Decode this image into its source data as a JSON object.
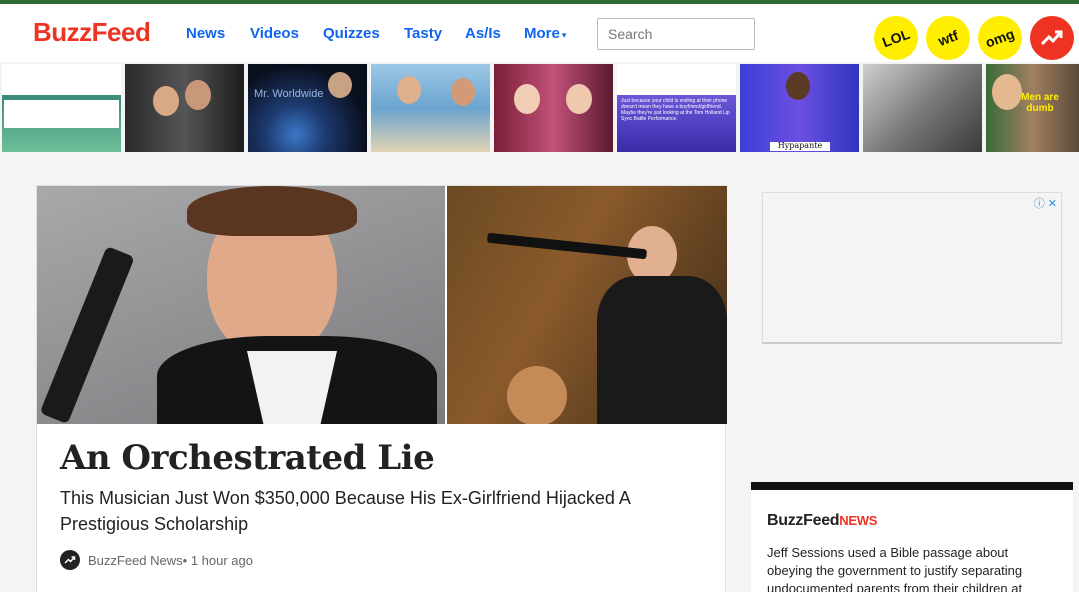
{
  "header": {
    "logo": "BuzzFeed",
    "nav": [
      {
        "label": "News"
      },
      {
        "label": "Videos"
      },
      {
        "label": "Quizzes"
      },
      {
        "label": "Tasty"
      },
      {
        "label": "As/Is"
      },
      {
        "label": "More"
      }
    ],
    "search_placeholder": "Search",
    "badges": [
      "LOL",
      "wtf",
      "omg",
      "trending"
    ]
  },
  "strip": {
    "captions": {
      "t6": "Just because your child is smiling at their phone doesn't mean they have a boyfriend/girlfriend. Maybe they're just looking at the Tom Holland Lip Sync Battle Performance.",
      "t7": "Hypapante",
      "t10": "Men are dumb",
      "t3": "Mr. Worldwide"
    }
  },
  "feature": {
    "headline": "An Orchestrated Lie",
    "subhead": "This Musician Just Won $350,000 Because His Ex-Girlfriend Hijacked A Prestigious Scholarship",
    "byline": "BuzzFeed News",
    "time": " • 1 hour ago"
  },
  "ad": {
    "icons": "ⓘ ✕"
  },
  "news_box": {
    "logo_main": "BuzzFeed",
    "logo_sub": "NEWS",
    "text": "Jeff Sessions used a Bible passage about obeying the government to justify separating undocumented parents from their children at"
  }
}
